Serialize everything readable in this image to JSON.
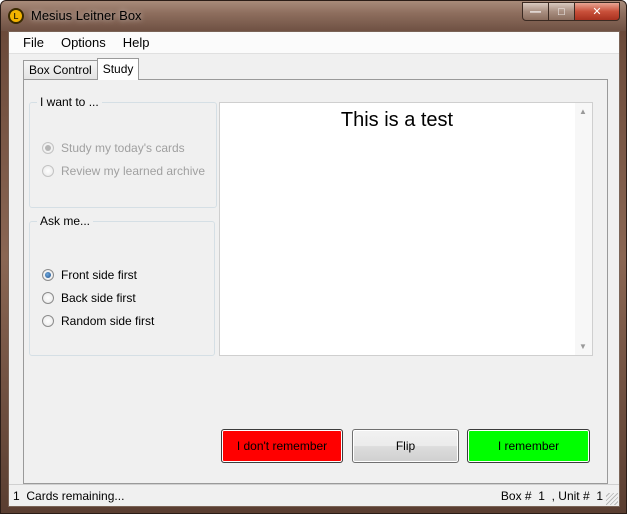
{
  "window": {
    "title": "Mesius Leitner Box"
  },
  "menu": {
    "file": "File",
    "options": "Options",
    "help": "Help"
  },
  "tabs": [
    {
      "label": "Box Control"
    },
    {
      "label": "Study"
    }
  ],
  "want_group": {
    "label": "I want to ...",
    "options": [
      {
        "label": "Study my today's cards",
        "checked": true
      },
      {
        "label": "Review my learned archive",
        "checked": false
      }
    ]
  },
  "ask_group": {
    "label": "Ask me...",
    "options": [
      {
        "label": "Front side first",
        "checked": true
      },
      {
        "label": "Back side first",
        "checked": false
      },
      {
        "label": "Random side first",
        "checked": false
      }
    ]
  },
  "card": {
    "text": "This is a test"
  },
  "buttons": {
    "dont_remember": "I don't remember",
    "flip": "Flip",
    "remember": "I remember"
  },
  "status": {
    "count": "1",
    "cards_remaining": "Cards remaining...",
    "box_label": "Box #",
    "box_value": "1",
    "unit_label": ", Unit #",
    "unit_value": "1"
  },
  "colors": {
    "dont_remember_bg": "#ff0000",
    "remember_bg": "#00ff00"
  }
}
